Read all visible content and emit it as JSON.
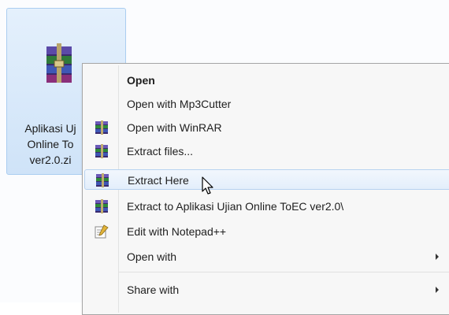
{
  "file": {
    "name_lines": [
      "Aplikasi Uj",
      "Online To",
      "ver2.0.zi"
    ],
    "icon": "winrar-archive-icon"
  },
  "menu": {
    "items": [
      {
        "label": "Open",
        "bold": true,
        "icon": null,
        "submenu": false
      },
      {
        "label": "Open with Mp3Cutter",
        "bold": false,
        "icon": null,
        "submenu": false
      },
      {
        "label": "Open with WinRAR",
        "bold": false,
        "icon": "winrar-icon",
        "submenu": false
      },
      {
        "label": "Extract files...",
        "bold": false,
        "icon": "winrar-icon",
        "submenu": false
      },
      {
        "label": "Extract Here",
        "bold": false,
        "icon": "winrar-icon",
        "submenu": false,
        "hover": true
      },
      {
        "label": "Extract to Aplikasi Ujian Online ToEC ver2.0\\",
        "bold": false,
        "icon": "winrar-icon",
        "submenu": false
      },
      {
        "label": "Edit with Notepad++",
        "bold": false,
        "icon": "notepad-plus-plus-icon",
        "submenu": false
      },
      {
        "label": "Open with",
        "bold": false,
        "icon": null,
        "submenu": true
      },
      {
        "label": "Share with",
        "bold": false,
        "icon": null,
        "submenu": true
      }
    ]
  },
  "colors": {
    "selection": "#cfe3f8",
    "menu_bg": "#f7f7f7",
    "hover_border": "#b7d2f0"
  }
}
